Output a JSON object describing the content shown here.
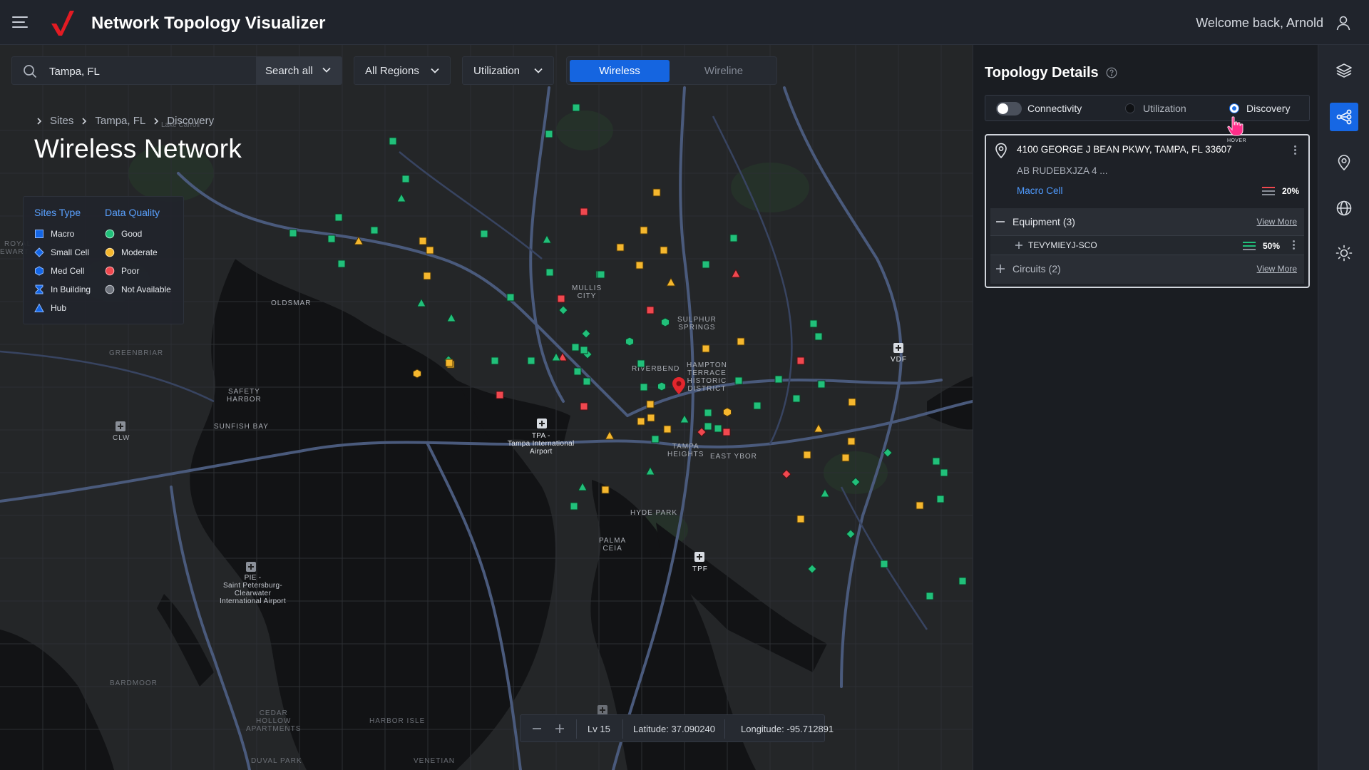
{
  "header": {
    "title": "Network Topology Visualizer",
    "welcome": "Welcome back, Arnold"
  },
  "colors": {
    "brand_red": "#e31b23",
    "accent_blue": "#1565e0",
    "good": "#21c07a",
    "moderate": "#f5b72e",
    "poor": "#f0484f",
    "not_available": "#8a8f98",
    "legend_head": "#5aa1ff"
  },
  "toolbar": {
    "search_value": "Tampa, FL",
    "search_scope": "Search all",
    "regions": "All Regions",
    "metric": "Utilization",
    "segments": [
      "Wireless",
      "Wireline"
    ],
    "active_segment": "Wireless"
  },
  "breadcrumb": [
    "Sites",
    "Tampa, FL",
    "Discovery"
  ],
  "page_title": "Wireless Network",
  "legend": {
    "sites_type_title": "Sites Type",
    "sites_type": [
      "Macro",
      "Small Cell",
      "Med Cell",
      "In Building",
      "Hub"
    ],
    "data_quality_title": "Data Quality",
    "data_quality": [
      "Good",
      "Moderate",
      "Poor",
      "Not Available"
    ]
  },
  "map_labels": {
    "oldsmar": "OLDSMAR",
    "greenbriar": "GREENBRIAR",
    "safety_harbor_1": "SAFETY",
    "safety_harbor_2": "HARBOR",
    "sunfish_bay": "SUNFISH BAY",
    "clw": "CLW",
    "mullis_1": "MULLIS",
    "mullis_2": "CITY",
    "sulphur_1": "SULPHUR",
    "sulphur_2": "SPRINGS",
    "riverbend": "RIVERBEND",
    "hampton_1": "HAMPTON",
    "hampton_2": "TERRACE",
    "hampton_3": "HISTORIC",
    "hampton_4": "DISTRICT",
    "tpa_1": "TPA -",
    "tpa_2": "Tampa International",
    "tpa_3": "Airport",
    "tampa_heights_1": "TAMPA",
    "tampa_heights_2": "HEIGHTS",
    "east_ybor": "EAST YBOR",
    "hyde_park": "HYDE PARK",
    "palma_1": "PALMA",
    "palma_2": "CEIA",
    "tpf": "TPF",
    "vdf": "VDF",
    "pie_1": "PIE -",
    "pie_2": "Saint Petersburg-",
    "pie_3": "Clearwater",
    "pie_4": "International Airport",
    "bardmoor": "BARDMOOR",
    "cedar_1": "CEDAR",
    "cedar_2": "HOLLOW",
    "cedar_3": "APARTMENTS",
    "harbor_isle": "HARBOR ISLE",
    "duval_park": "DUVAL PARK",
    "venetian": "VENETIAN",
    "royal": "ROYAL",
    "ewart": "EWART",
    "lake_carroll": "Lake Carroll"
  },
  "status": {
    "level": "Lv 15",
    "latitude_label": "Latitude:",
    "latitude": "37.090240",
    "longitude_label": "Longitude:",
    "longitude": "-95.712891"
  },
  "panel": {
    "title": "Topology Details",
    "tabs": [
      "Connectivity",
      "Utilization",
      "Discovery"
    ],
    "selected_tab": "Discovery",
    "hover_badge": "HOVER",
    "site": {
      "address": "4100 GEORGE J BEAN PKWY, TAMPA, FL 33607",
      "code": "AB RUDEBXJZA 4 ...",
      "type": "Macro Cell",
      "utilization": "20%"
    },
    "equipment": {
      "label": "Equipment (3)",
      "view_more": "View More",
      "items": [
        {
          "name": "TEVYMIEYJ-SCO",
          "utilization": "50%"
        }
      ]
    },
    "circuits": {
      "label": "Circuits (2)",
      "view_more": "View More"
    }
  },
  "rail": [
    "layers-icon",
    "topology-icon",
    "location-pin-icon",
    "globe-icon",
    "brightness-icon"
  ]
}
